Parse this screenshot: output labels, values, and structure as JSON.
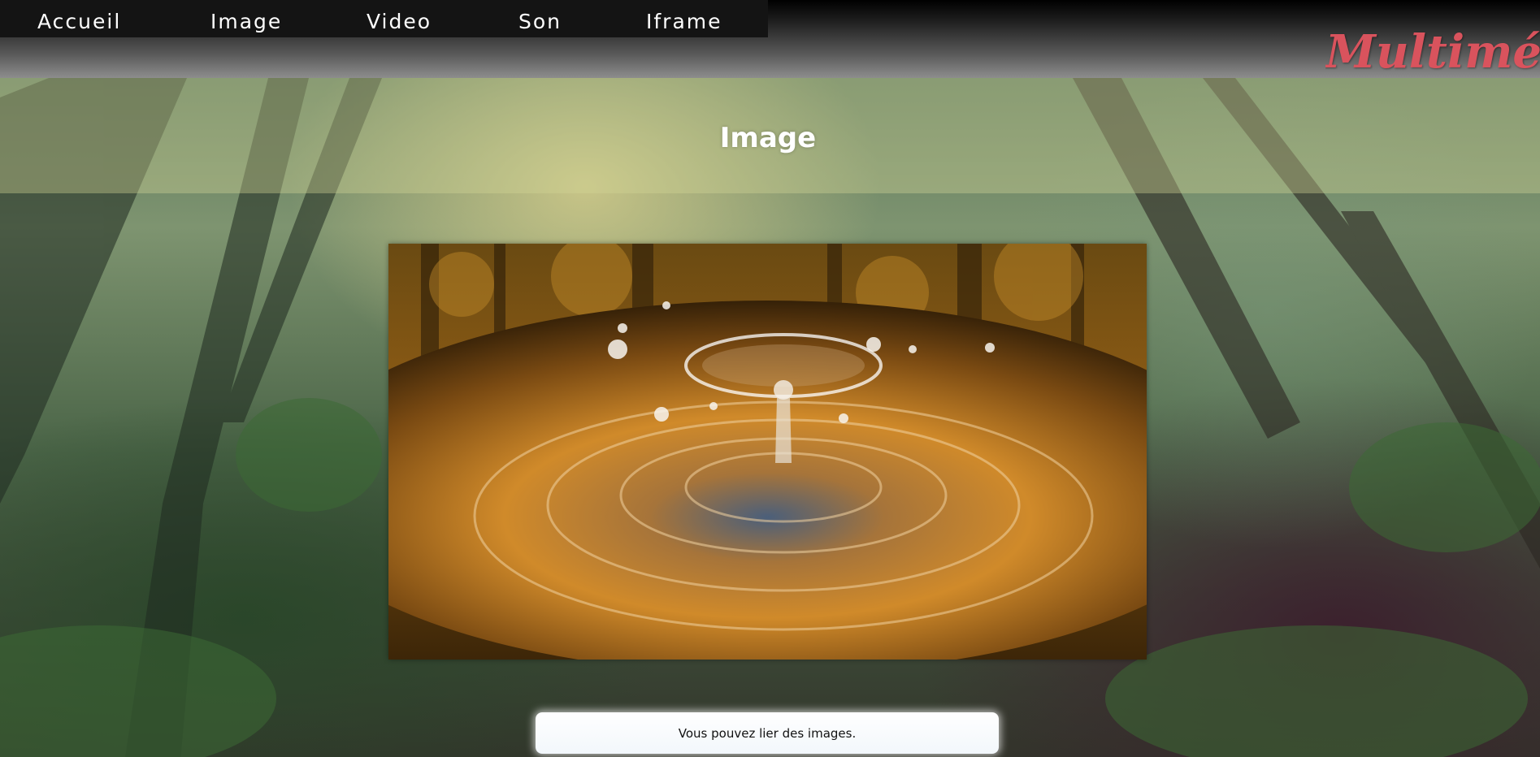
{
  "nav": {
    "items": [
      {
        "label": "Accueil"
      },
      {
        "label": "Image"
      },
      {
        "label": "Video"
      },
      {
        "label": "Son"
      },
      {
        "label": "Iframe"
      }
    ]
  },
  "brand": {
    "title": "Multimédia",
    "color": "#d9535d"
  },
  "section": {
    "title": "Image"
  },
  "main_image": {
    "subject": "water-drop-splash"
  },
  "caption": {
    "text": "Vous pouvez lier des images."
  }
}
